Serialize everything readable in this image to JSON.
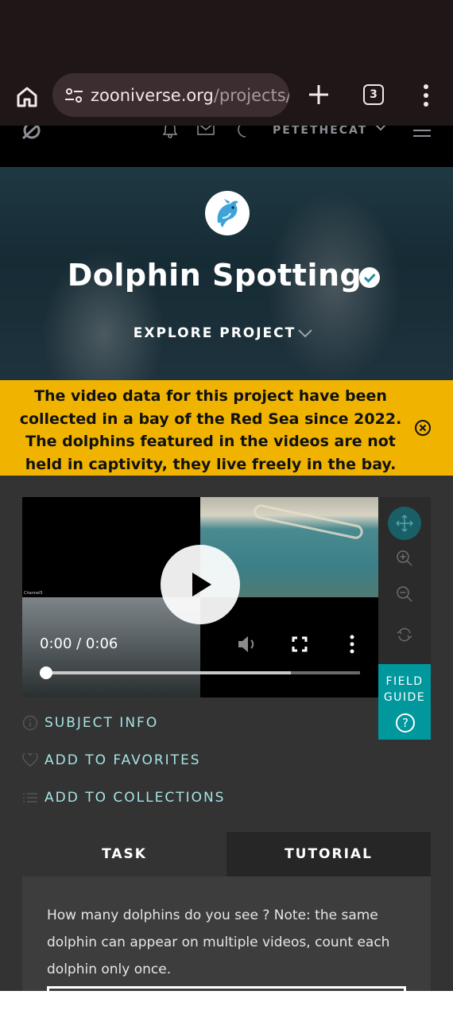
{
  "browser": {
    "url_host": "zooniverse.org",
    "url_path": "/projects/",
    "tab_count": "3"
  },
  "zoo_nav": {
    "username": "PETETHECAT"
  },
  "hero": {
    "title": "Dolphin Spotting",
    "explore_label": "EXPLORE PROJECT"
  },
  "banner": {
    "message": "The video data for this project have been collected in a bay of the Red Sea since 2022. The dolphins featured in the videos are not held in captivity, they live freely in the bay."
  },
  "video": {
    "time": "0:00 / 0:06",
    "channel_label": "Channel5",
    "progress_buffered": 0.78
  },
  "tools": {
    "field_guide_label": "FIELD GUIDE",
    "field_guide_icon": "?"
  },
  "subject_links": {
    "info": "SUBJECT INFO",
    "favorites": "ADD TO FAVORITES",
    "collections": "ADD TO COLLECTIONS"
  },
  "task": {
    "tabs": [
      {
        "label": "TASK"
      },
      {
        "label": "TUTORIAL"
      }
    ],
    "question": "How many dolphins do you see ? Note: the same dolphin can appear on multiple videos, count each dolphin only once."
  },
  "colors": {
    "browser_bg": "#1f1618",
    "banner": "#f0b400",
    "accent_teal": "#00979d",
    "link_teal": "#a5e3e5",
    "panel_bg": "#333333"
  }
}
